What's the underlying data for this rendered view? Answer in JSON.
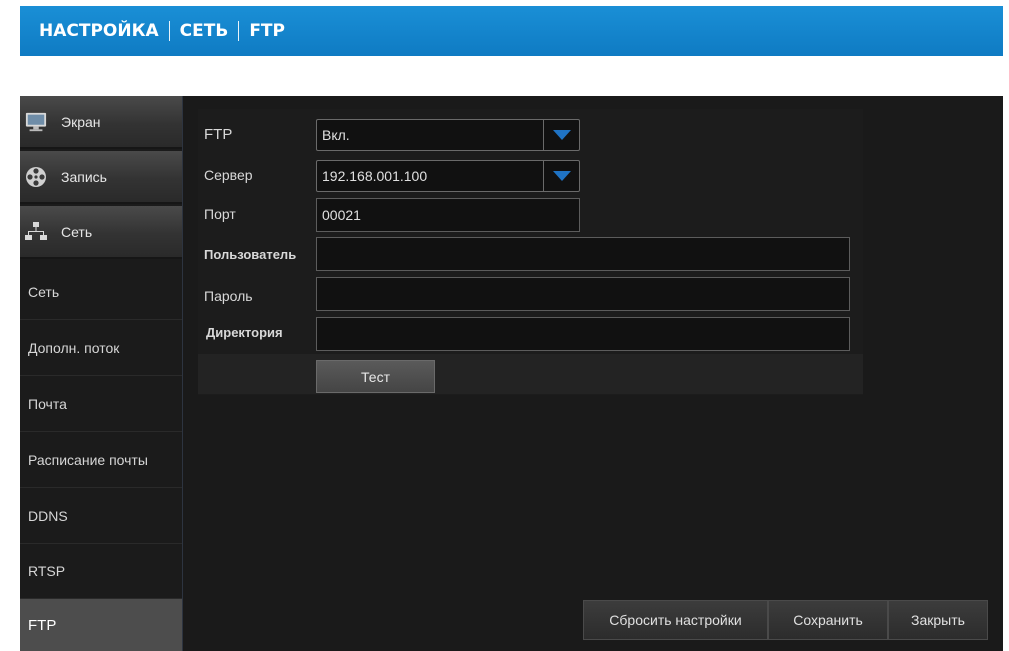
{
  "breadcrumb": [
    "НАСТРОЙКА",
    "СЕТЬ",
    "FTP"
  ],
  "sidebar": {
    "categories": [
      {
        "label": "Экран",
        "icon": "monitor-icon"
      },
      {
        "label": "Запись",
        "icon": "film-reel-icon"
      },
      {
        "label": "Сеть",
        "icon": "network-icon"
      }
    ],
    "items": [
      "Сеть",
      "Дополн. поток",
      "Почта",
      "Расписание почты",
      "DDNS",
      "RTSP",
      "FTP"
    ],
    "active": "FTP"
  },
  "form": {
    "ftp": {
      "label": "FTP",
      "value": "Вкл."
    },
    "server": {
      "label": "Сервер",
      "value": "192.168.001.100"
    },
    "port": {
      "label": "Порт",
      "value": "00021"
    },
    "user": {
      "label": "Пользователь",
      "value": ""
    },
    "password": {
      "label": "Пароль",
      "value": ""
    },
    "directory": {
      "label": "Директория",
      "value": ""
    },
    "test_label": "Тест"
  },
  "buttons": {
    "reset": "Сбросить настройки",
    "save": "Сохранить",
    "close": "Закрыть"
  },
  "colors": {
    "header": "#1387cf",
    "arrow": "#1f73c4",
    "active_item": "#4d4d4d"
  }
}
